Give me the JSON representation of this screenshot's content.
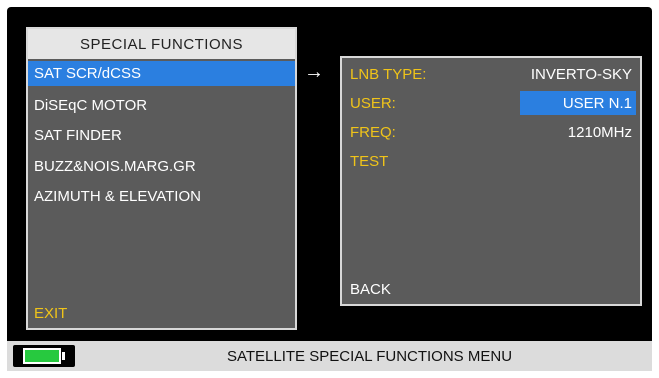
{
  "left_panel": {
    "title": "SPECIAL FUNCTIONS",
    "items": [
      {
        "label": "SAT SCR/dCSS"
      },
      {
        "label": "DiSEqC MOTOR"
      },
      {
        "label": "SAT FINDER"
      },
      {
        "label": "BUZZ&NOIS.MARG.GR"
      },
      {
        "label": "AZIMUTH & ELEVATION"
      }
    ],
    "exit_label": "EXIT"
  },
  "arrow_glyph": "→",
  "right_panel": {
    "rows": [
      {
        "label": "LNB TYPE:",
        "value": "INVERTO-SKY"
      },
      {
        "label": "USER:",
        "value": "USER N.1"
      },
      {
        "label": "FREQ:",
        "value": "1210MHz"
      },
      {
        "label": "TEST",
        "value": ""
      }
    ],
    "back_label": "BACK"
  },
  "status_bar": {
    "text": "SATELLITE SPECIAL FUNCTIONS MENU",
    "battery_icon": "battery-icon"
  },
  "colors": {
    "highlight": "#2b7fe0",
    "label_yellow": "#f0c419",
    "panel_gray": "#5b5b5b"
  }
}
